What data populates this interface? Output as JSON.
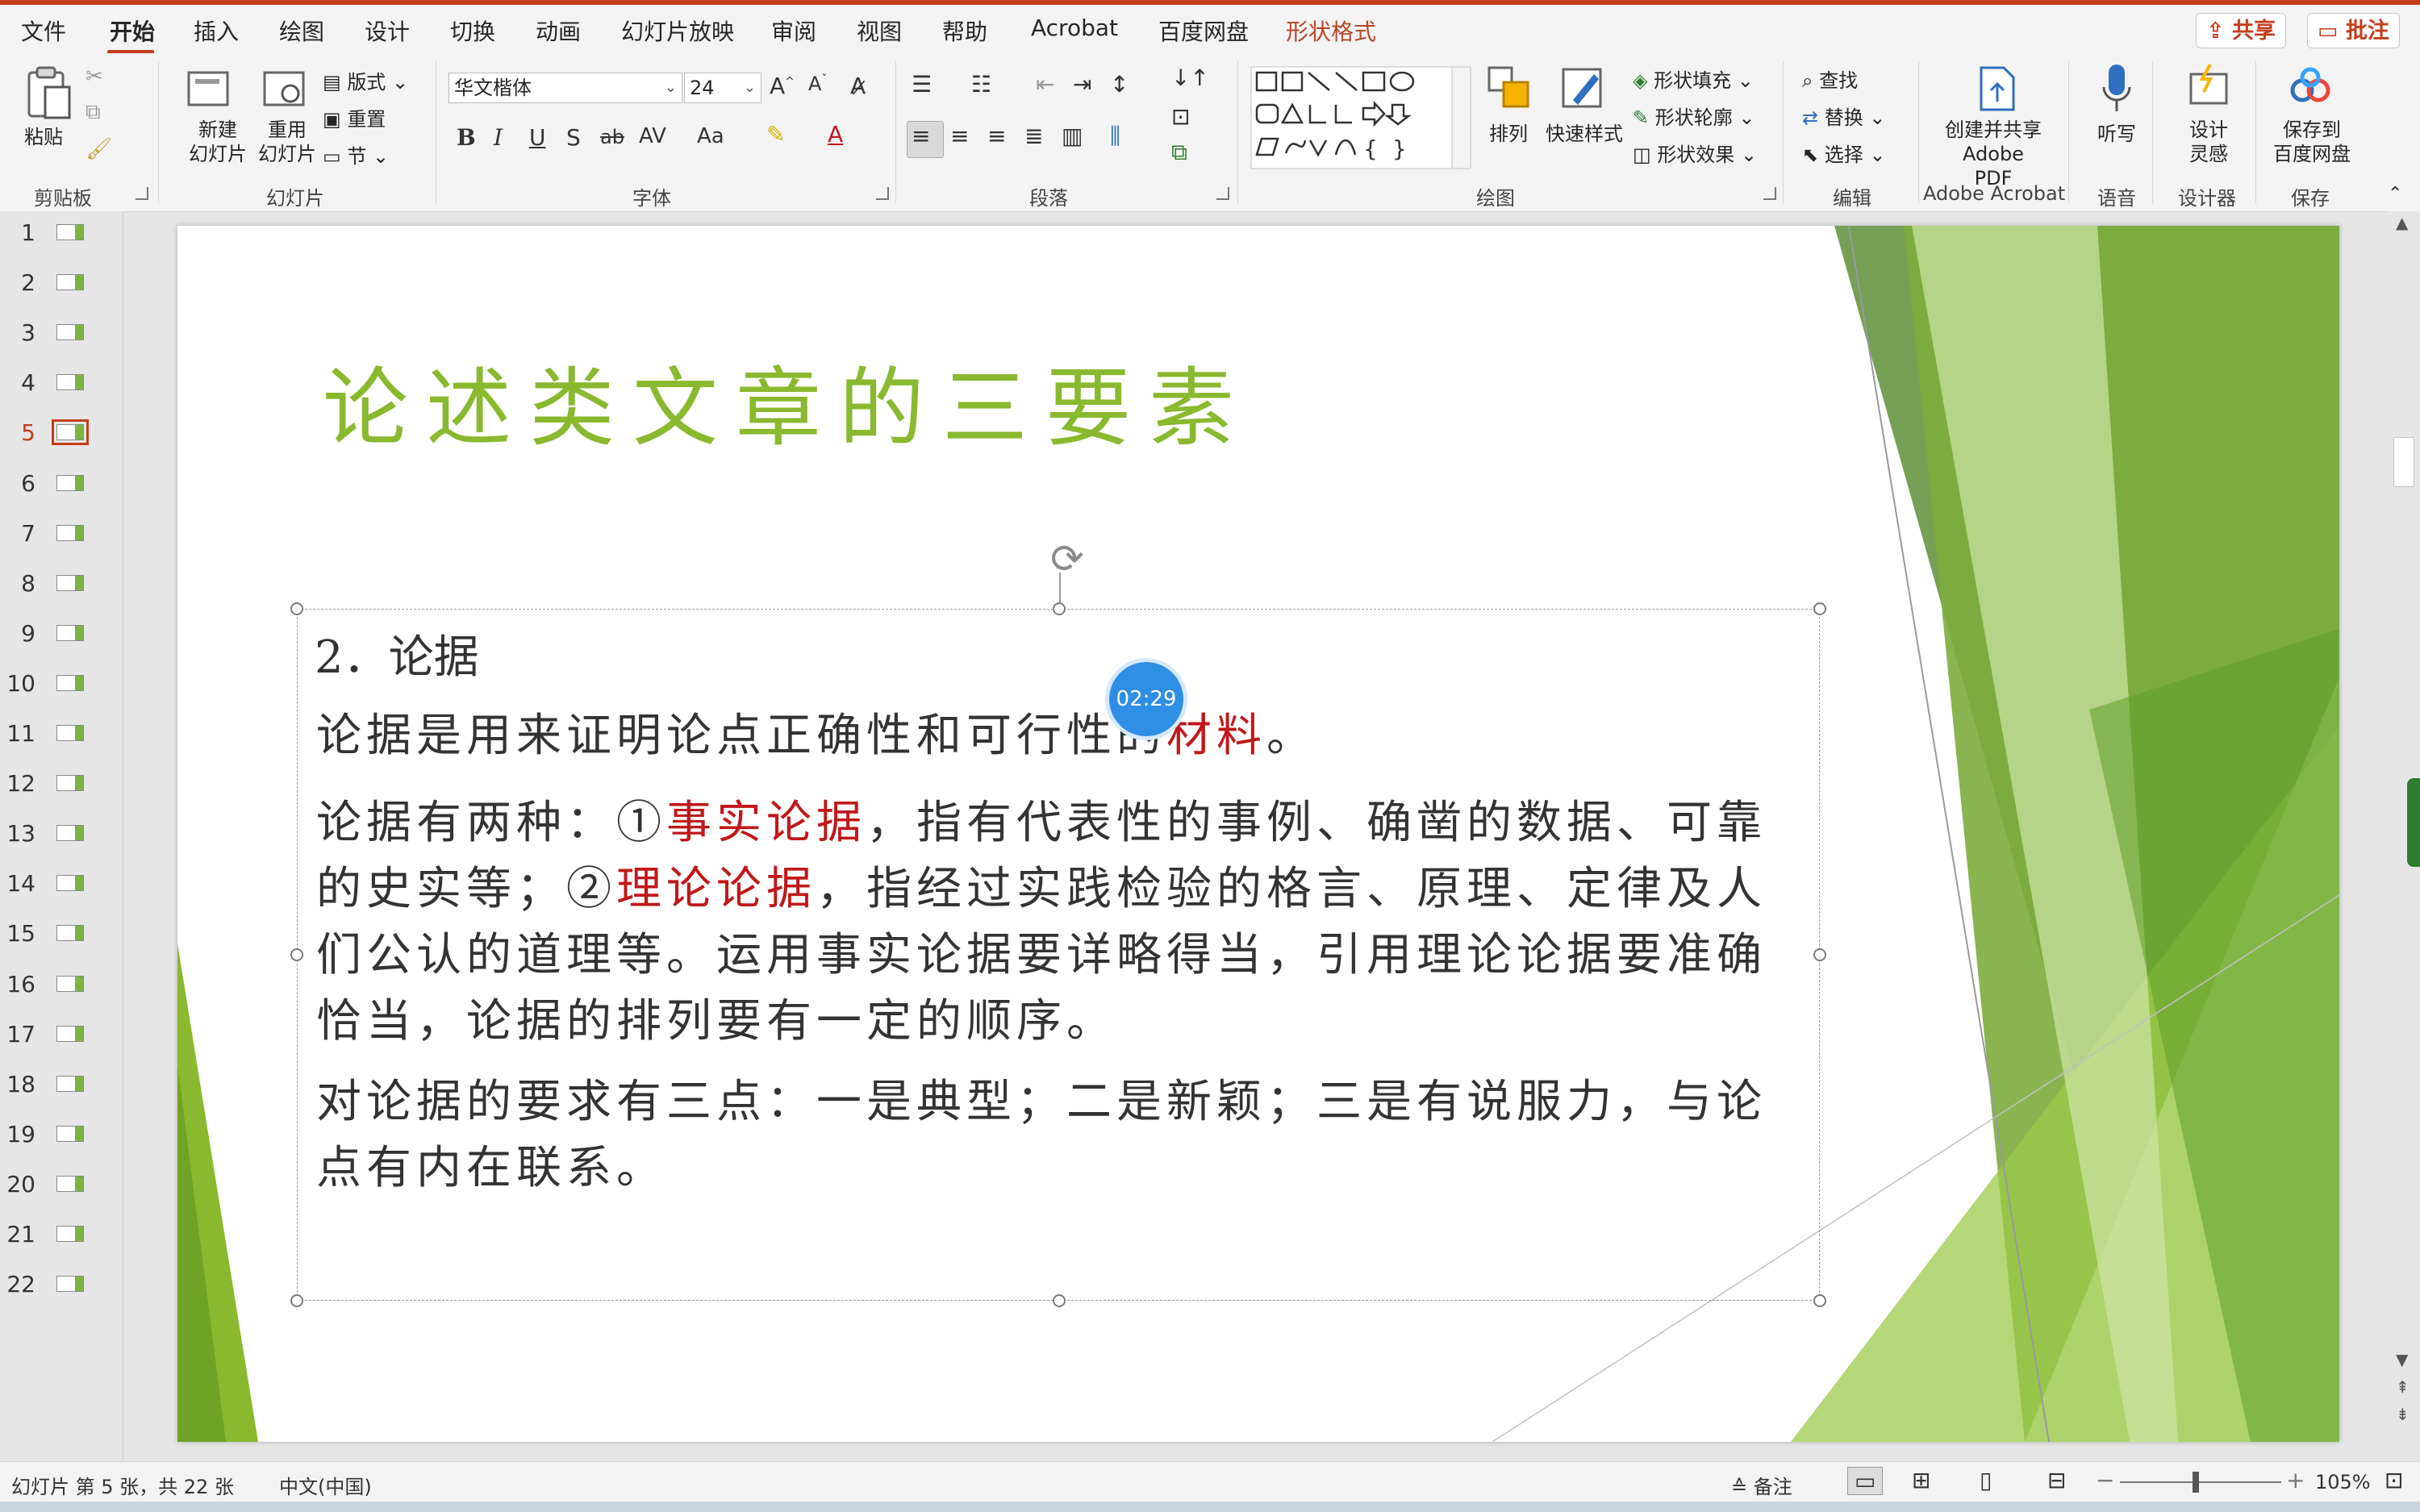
{
  "tabs": [
    "文件",
    "开始",
    "插入",
    "绘图",
    "设计",
    "切换",
    "动画",
    "幻灯片放映",
    "审阅",
    "视图",
    "帮助",
    "Acrobat",
    "百度网盘",
    "形状格式"
  ],
  "share_label": "共享",
  "comment_label": "批注",
  "ribbon": {
    "clipboard": {
      "paste": "粘贴",
      "group": "剪贴板"
    },
    "slides": {
      "new_slide": "新建\n幻灯片",
      "reuse": "重用\n幻灯片",
      "layout": "版式",
      "reset": "重置",
      "section": "节",
      "group": "幻灯片"
    },
    "font": {
      "font_name": "华文楷体",
      "font_size": "24",
      "group": "字体",
      "bold": "B",
      "italic": "I",
      "underline": "U",
      "shadow": "S",
      "strike": "ab",
      "spacing": "AV",
      "case": "Aa"
    },
    "paragraph": {
      "group": "段落"
    },
    "drawing": {
      "arrange": "排列",
      "quick_styles": "快速样式",
      "fill": "形状填充",
      "outline": "形状轮廓",
      "effects": "形状效果",
      "group": "绘图"
    },
    "editing": {
      "find": "查找",
      "replace": "替换",
      "select": "选择",
      "group": "编辑"
    },
    "acrobat": {
      "create": "创建并共享\nAdobe PDF",
      "group": "Adobe Acrobat"
    },
    "voice": {
      "dictate": "听写",
      "group": "语音"
    },
    "designer": {
      "design": "设计\n灵感",
      "group": "设计器"
    },
    "save": {
      "save": "保存到\n百度网盘",
      "group": "保存"
    }
  },
  "thumbnails": [
    "1",
    "2",
    "3",
    "4",
    "5",
    "6",
    "7",
    "8",
    "9",
    "10",
    "11",
    "12",
    "13",
    "14",
    "15",
    "16",
    "17",
    "18",
    "19",
    "20",
    "21",
    "22"
  ],
  "selected_slide": 5,
  "slide": {
    "title": "论述类文章的三要素",
    "heading": "2．论据",
    "p1_a": "论据是用来证明论点正确性和可行性的",
    "p1_red": "材料",
    "p1_b": "。",
    "p2_a": "论据有两种：①",
    "p2_red1": "事实论据",
    "p2_b": "，指有代表性的事例、确凿的数据、可靠的史实等；②",
    "p2_red2": "理论论据",
    "p2_c": "，指经过实践检验的格言、原理、定律及人们公认的道理等。运用事实论据要详略得当，引用理论论据要准确恰当，论据的排列要有一定的顺序。",
    "p3": "对论据的要求有三点：一是典型；二是新颖；三是有说服力，与论点有内在联系。"
  },
  "timer": "02:29",
  "status": {
    "slide_info": "幻灯片 第 5 张，共 22 张",
    "language": "中文(中国)",
    "notes": "备注",
    "zoom": "105%"
  },
  "colors": {
    "accent": "#c43e1c",
    "title_green": "#8ab82e",
    "red_text": "#c0181b"
  }
}
